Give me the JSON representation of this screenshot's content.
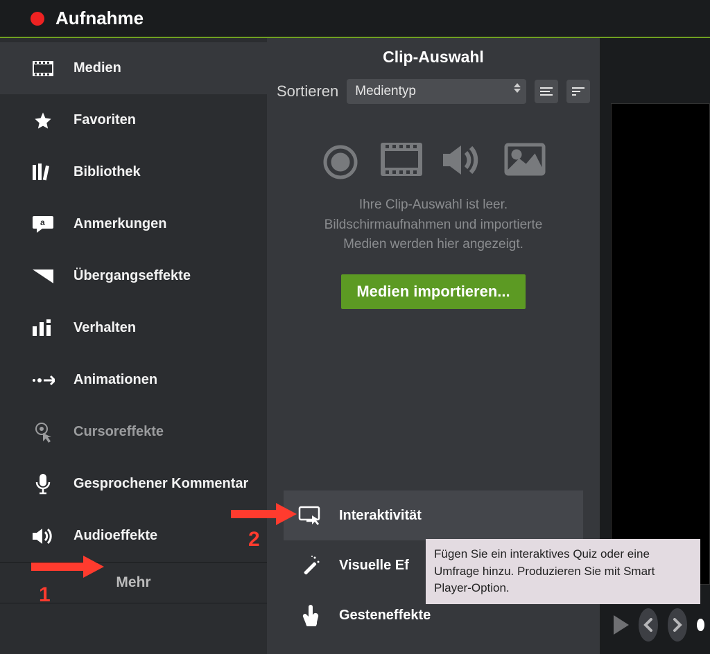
{
  "topbar": {
    "title": "Aufnahme"
  },
  "sidebar": {
    "items": [
      {
        "label": "Medien"
      },
      {
        "label": "Favoriten"
      },
      {
        "label": "Bibliothek"
      },
      {
        "label": "Anmerkungen"
      },
      {
        "label": "Übergangseffekte"
      },
      {
        "label": "Verhalten"
      },
      {
        "label": "Animationen"
      },
      {
        "label": "Cursoreffekte"
      },
      {
        "label": "Gesprochener Kommentar"
      },
      {
        "label": "Audioeffekte"
      }
    ],
    "more": "Mehr"
  },
  "center": {
    "title": "Clip-Auswahl",
    "sort_label": "Sortieren",
    "sort_value": "Medientyp",
    "placeholder_text": "Ihre Clip-Auswahl ist leer. Bildschirmaufnahmen und importierte Medien werden hier angezeigt.",
    "import_label": "Medien importieren..."
  },
  "popup": {
    "items": [
      {
        "label": "Interaktivität"
      },
      {
        "label": "Visuelle Ef"
      },
      {
        "label": "Gesteneffekte"
      }
    ]
  },
  "tooltip": "Fügen Sie ein interaktives Quiz oder eine Umfrage hinzu. Produzieren Sie mit Smart Player-Option.",
  "callouts": {
    "one": "1",
    "two": "2"
  }
}
